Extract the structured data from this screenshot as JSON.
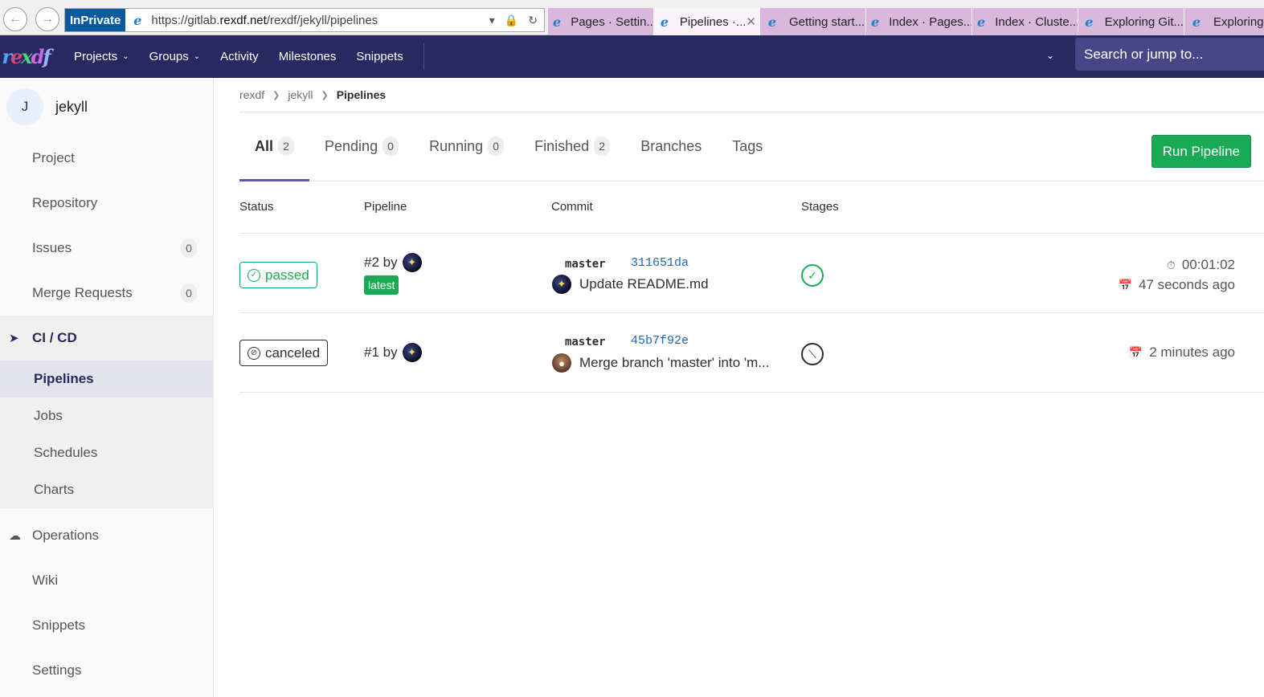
{
  "browser": {
    "inprivate_label": "InPrivate",
    "url_prefix": "https://gitlab.",
    "url_domain": "rexdf.net",
    "url_path": "/rexdf/jekyll/pipelines",
    "tabs": [
      {
        "title": "Pages · Settin..."
      },
      {
        "title": "Pipelines ·...",
        "active": true
      },
      {
        "title": "Getting start..."
      },
      {
        "title": "Index · Pages..."
      },
      {
        "title": "Index · Cluste..."
      },
      {
        "title": "Exploring Git..."
      },
      {
        "title": "Exploring"
      }
    ]
  },
  "topnav": {
    "logo": [
      "r",
      "e",
      "x",
      "d",
      "f"
    ],
    "links": [
      {
        "label": "Projects",
        "dropdown": true
      },
      {
        "label": "Groups",
        "dropdown": true
      },
      {
        "label": "Activity"
      },
      {
        "label": "Milestones"
      },
      {
        "label": "Snippets"
      }
    ],
    "search_placeholder": "Search or jump to..."
  },
  "sidebar": {
    "project_initial": "J",
    "project_name": "jekyll",
    "items_top": [
      {
        "label": "Project"
      },
      {
        "label": "Repository"
      },
      {
        "label": "Issues",
        "badge": "0"
      },
      {
        "label": "Merge Requests",
        "badge": "0"
      }
    ],
    "cicd": {
      "label": "CI / CD",
      "icon": "rocket-icon",
      "subitems": [
        {
          "label": "Pipelines",
          "active": true
        },
        {
          "label": "Jobs"
        },
        {
          "label": "Schedules"
        },
        {
          "label": "Charts"
        }
      ]
    },
    "items_bottom": [
      {
        "label": "Operations",
        "icon": "cloud-gear-icon"
      },
      {
        "label": "Wiki"
      },
      {
        "label": "Snippets"
      },
      {
        "label": "Settings"
      }
    ]
  },
  "breadcrumb": [
    "rexdf",
    "jekyll",
    "Pipelines"
  ],
  "pipeline_tabs": [
    {
      "label": "All",
      "count": "2",
      "active": true
    },
    {
      "label": "Pending",
      "count": "0"
    },
    {
      "label": "Running",
      "count": "0"
    },
    {
      "label": "Finished",
      "count": "2"
    },
    {
      "label": "Branches"
    },
    {
      "label": "Tags"
    }
  ],
  "run_pipeline_label": "Run Pipeline",
  "columns": [
    "Status",
    "Pipeline",
    "Commit",
    "Stages"
  ],
  "pipelines": [
    {
      "status": "passed",
      "id_text": "#2 by",
      "latest_label": "latest",
      "branch": "master",
      "sha": "311651da",
      "message": "Update README.md",
      "stage_status": "success",
      "duration": "00:01:02",
      "finished": "47 seconds ago"
    },
    {
      "status": "canceled",
      "id_text": "#1 by",
      "branch": "master",
      "sha": "45b7f92e",
      "message": "Merge branch 'master' into 'm...",
      "stage_status": "canceled",
      "finished": "2 minutes ago"
    }
  ],
  "colors": {
    "accent": "#292961",
    "success": "#1aaa55",
    "tab_underline": "#6b4fbb",
    "link": "#1b69b6"
  }
}
